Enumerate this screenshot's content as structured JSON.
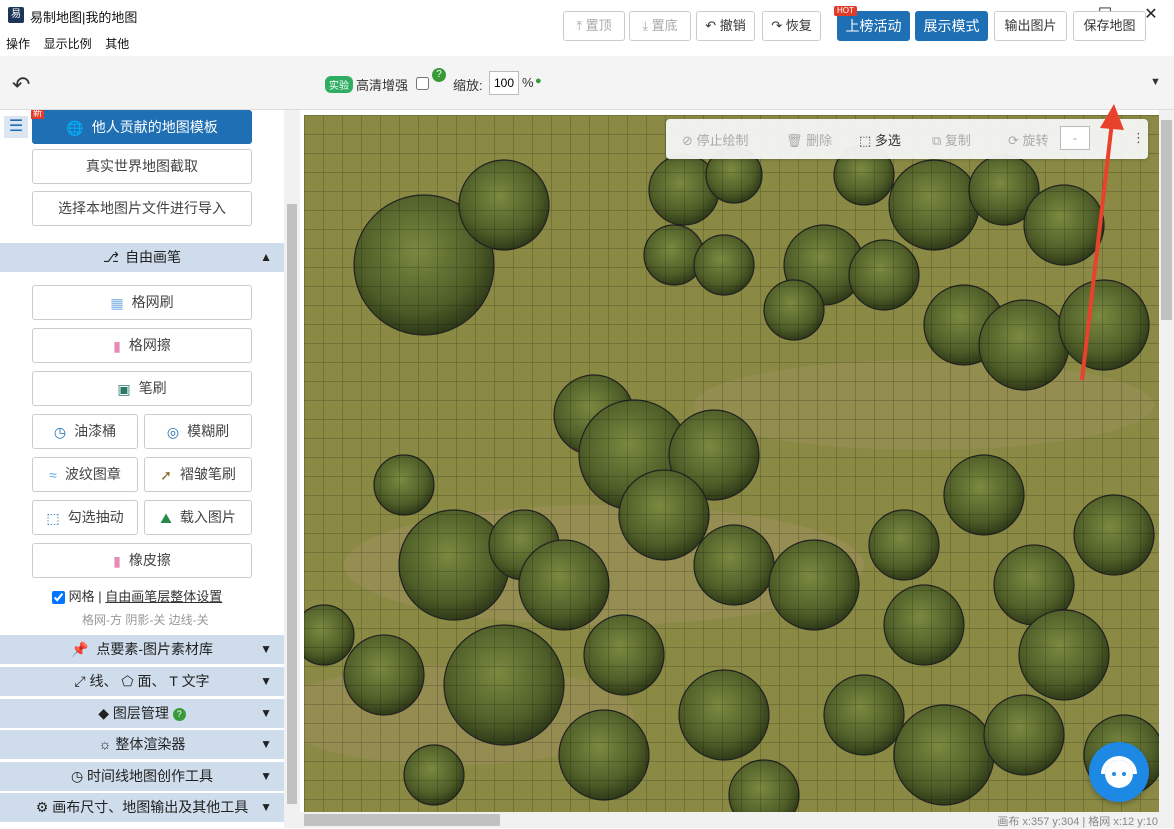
{
  "window": {
    "title": "易制地图|我的地图",
    "icon_text": "易"
  },
  "menu": [
    "操作",
    "显示比例",
    "其他"
  ],
  "toolbar": {
    "badge": "实验",
    "hd_label": "高清增强",
    "zoom_label": "缩放:",
    "zoom_value": "100",
    "zoom_unit": "%",
    "top": "置顶",
    "bottom": "置底",
    "undo": "撤销",
    "redo": "恢复",
    "hot": "HOT",
    "ranking": "上榜活动",
    "display_mode": "展示模式",
    "export_image": "输出图片",
    "save_map": "保存地图"
  },
  "sidebar": {
    "new_badge": "新",
    "template_btn": "他人贡献的地图模板",
    "real_world_btn": "真实世界地图截取",
    "import_btn": "选择本地图片文件进行导入",
    "free_brush_title": "自由画笔",
    "grid_brush": "格网刷",
    "grid_eraser": "格网擦",
    "pen_brush": "笔刷",
    "paint_bucket": "油漆桶",
    "blur_brush": "模糊刷",
    "wave_stamp": "波纹图章",
    "wrinkle_brush": "褶皱笔刷",
    "outline_brush": "勾选抽动",
    "load_image": "载入图片",
    "eraser": "橡皮擦",
    "grid_check": "网格",
    "separator": "|",
    "settings_link": "自由画笔层整体设置",
    "grid_info": "格网-方 阴影-关 边线-关",
    "sections": [
      "点要素-图片素材库",
      "线、",
      "面、",
      "文字",
      "图层管理",
      "整体渲染器",
      "时间线地图创作工具",
      "画布尺寸、地图输出及其他工具"
    ]
  },
  "canvas_tools": {
    "stop_draw": "停止绘制",
    "delete": "删除",
    "multi_select": "多选",
    "copy": "复制",
    "rotate": "旋转",
    "rotate_value": "-"
  },
  "status": "画布 x:357 y:304 | 格网 x:12 y:10",
  "colors": {
    "accent": "#1e6fb3",
    "section_bg": "#cfdcec",
    "grass": "#8a8a45",
    "tree": "#4f5e28"
  }
}
